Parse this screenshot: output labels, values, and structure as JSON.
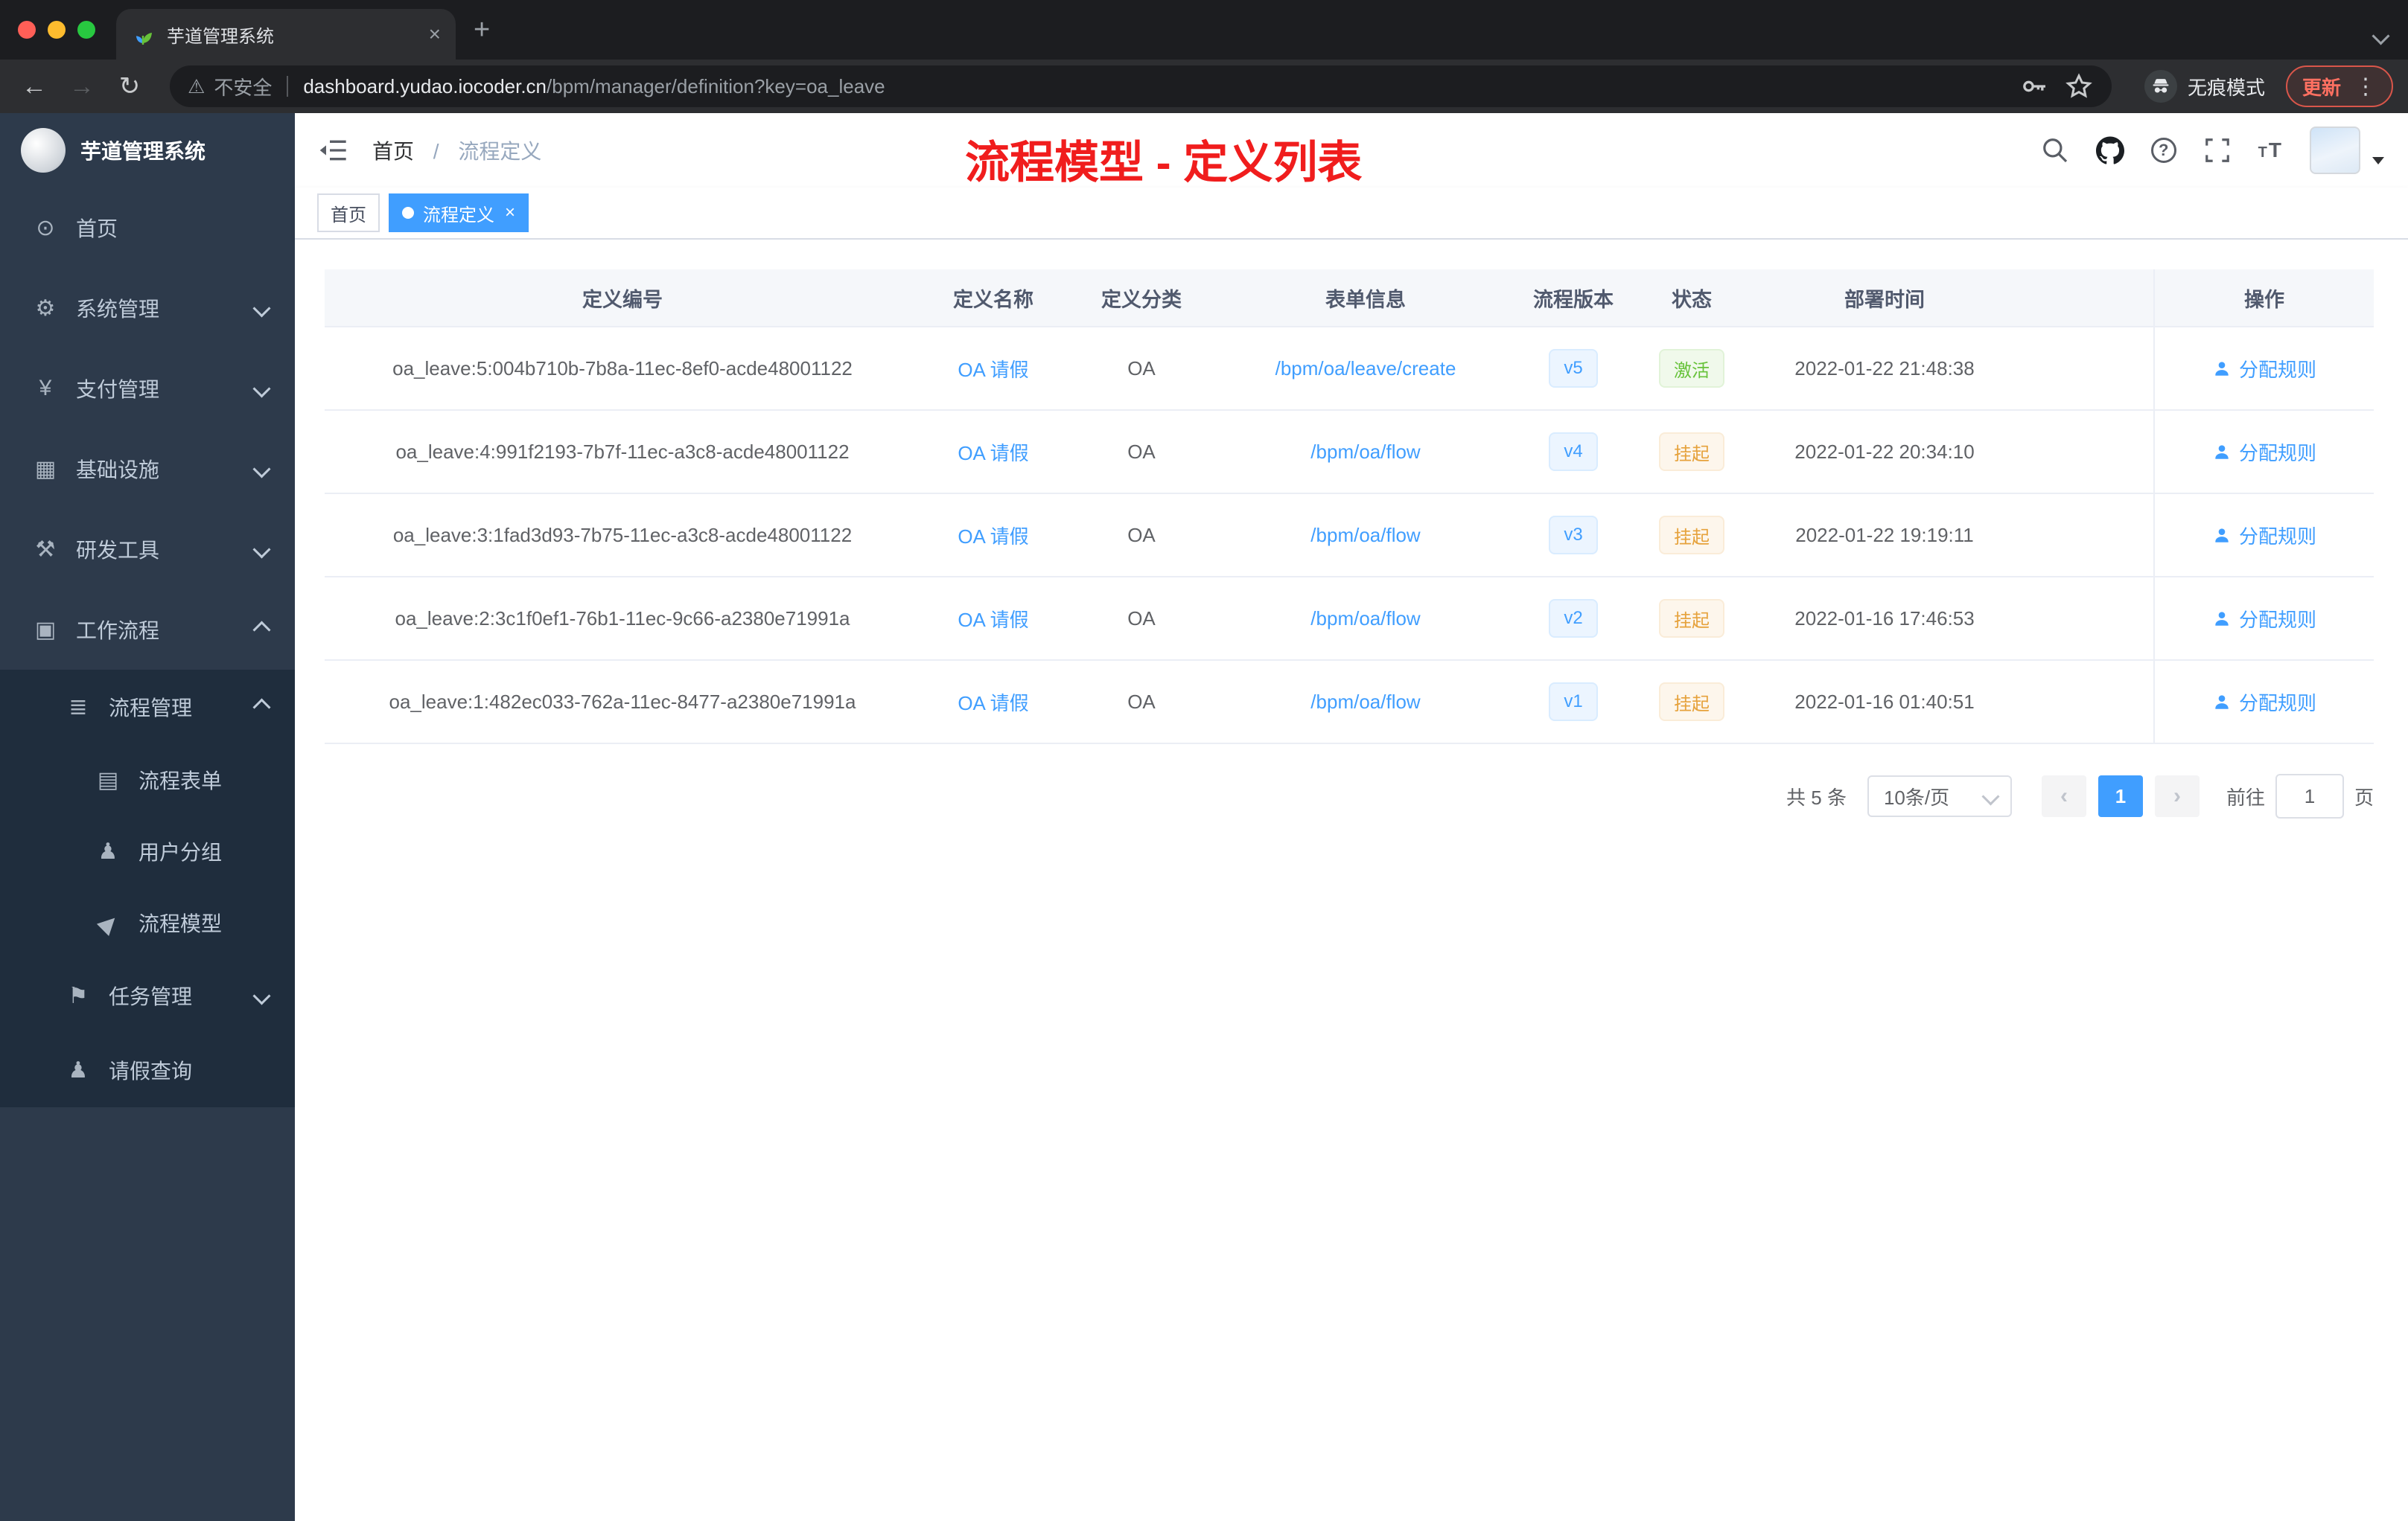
{
  "browser": {
    "tab_title": "芋道管理系统",
    "new_tab": "+",
    "security_label": "不安全",
    "url_host": "dashboard.yudao.iocoder.cn",
    "url_path": "/bpm/manager/definition?key=oa_leave",
    "incognito_label": "无痕模式",
    "update_label": "更新"
  },
  "sidebar": {
    "logo_title": "芋道管理系统",
    "items": [
      {
        "label": "首页"
      },
      {
        "label": "系统管理"
      },
      {
        "label": "支付管理"
      },
      {
        "label": "基础设施"
      },
      {
        "label": "研发工具"
      },
      {
        "label": "工作流程"
      },
      {
        "label": "流程管理"
      },
      {
        "label": "流程表单"
      },
      {
        "label": "用户分组"
      },
      {
        "label": "流程模型"
      },
      {
        "label": "任务管理"
      },
      {
        "label": "请假查询"
      }
    ]
  },
  "header": {
    "breadcrumb_home": "首页",
    "breadcrumb_separator": "/",
    "breadcrumb_current": "流程定义",
    "annotation": "流程模型 - 定义列表"
  },
  "tags": {
    "home": "首页",
    "active": "流程定义"
  },
  "table": {
    "headers": [
      "定义编号",
      "定义名称",
      "定义分类",
      "表单信息",
      "流程版本",
      "状态",
      "部署时间",
      "操作"
    ],
    "rows": [
      {
        "id": "oa_leave:5:004b710b-7b8a-11ec-8ef0-acde48001122",
        "name": "OA 请假",
        "category": "OA",
        "form": "/bpm/oa/leave/create",
        "version": "v5",
        "status": "激活",
        "status_type": "success",
        "deployed_at": "2022-01-22 21:48:38",
        "action": "分配规则"
      },
      {
        "id": "oa_leave:4:991f2193-7b7f-11ec-a3c8-acde48001122",
        "name": "OA 请假",
        "category": "OA",
        "form": "/bpm/oa/flow",
        "version": "v4",
        "status": "挂起",
        "status_type": "warning",
        "deployed_at": "2022-01-22 20:34:10",
        "action": "分配规则"
      },
      {
        "id": "oa_leave:3:1fad3d93-7b75-11ec-a3c8-acde48001122",
        "name": "OA 请假",
        "category": "OA",
        "form": "/bpm/oa/flow",
        "version": "v3",
        "status": "挂起",
        "status_type": "warning",
        "deployed_at": "2022-01-22 19:19:11",
        "action": "分配规则"
      },
      {
        "id": "oa_leave:2:3c1f0ef1-76b1-11ec-9c66-a2380e71991a",
        "name": "OA 请假",
        "category": "OA",
        "form": "/bpm/oa/flow",
        "version": "v2",
        "status": "挂起",
        "status_type": "warning",
        "deployed_at": "2022-01-16 17:46:53",
        "action": "分配规则"
      },
      {
        "id": "oa_leave:1:482ec033-762a-11ec-8477-a2380e71991a",
        "name": "OA 请假",
        "category": "OA",
        "form": "/bpm/oa/flow",
        "version": "v1",
        "status": "挂起",
        "status_type": "warning",
        "deployed_at": "2022-01-16 01:40:51",
        "action": "分配规则"
      }
    ]
  },
  "pagination": {
    "total": "共 5 条",
    "page_size": "10条/页",
    "page": "1",
    "goto_label": "前往",
    "goto_value": "1",
    "unit_label": "页"
  },
  "colors": {
    "accent": "#409EFF",
    "success": "#67C23A",
    "warning": "#E6A23C",
    "annotation_red": "#F01D1D",
    "sidebar_bg": "#2D3A4B",
    "submenu_bg": "#1F2D3D"
  }
}
